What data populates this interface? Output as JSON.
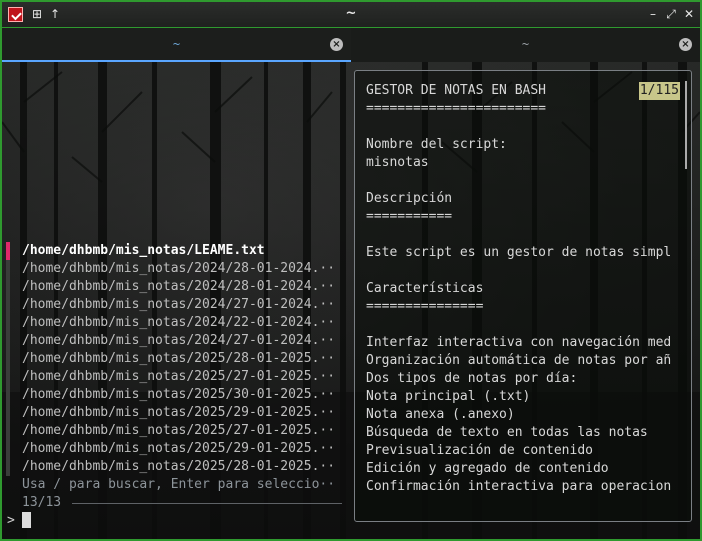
{
  "window": {
    "title": "~",
    "titlebar_buttons": {
      "grid": "⊞",
      "up": "↑",
      "minimize": "–",
      "maximize": "⤢",
      "close": "✕"
    },
    "border_color": "#2f9a2f"
  },
  "tabs": [
    {
      "label": "~",
      "active": true,
      "close": "×"
    },
    {
      "label": "~",
      "active": false,
      "close": "×"
    }
  ],
  "file_list": [
    "/home/dhbmb/mis_notas/LEAME.txt",
    "/home/dhbmb/mis_notas/2024/28-01-2024.··",
    "/home/dhbmb/mis_notas/2024/28-01-2024.··",
    "/home/dhbmb/mis_notas/2024/27-01-2024.··",
    "/home/dhbmb/mis_notas/2024/22-01-2024.··",
    "/home/dhbmb/mis_notas/2024/27-01-2024.··",
    "/home/dhbmb/mis_notas/2025/28-01-2025.··",
    "/home/dhbmb/mis_notas/2025/27-01-2025.··",
    "/home/dhbmb/mis_notas/2025/30-01-2025.··",
    "/home/dhbmb/mis_notas/2025/29-01-2025.··",
    "/home/dhbmb/mis_notas/2025/27-01-2025.··",
    "/home/dhbmb/mis_notas/2025/29-01-2025.··",
    "/home/dhbmb/mis_notas/2025/28-01-2025.··"
  ],
  "selected_index": 0,
  "hint": "Usa / para buscar, Enter para seleccio··",
  "counter": "13/13",
  "prompt": ">",
  "preview": {
    "position": "1/115",
    "lines": [
      "GESTOR DE NOTAS EN BASH",
      "=======================",
      "",
      "Nombre del script:",
      "misnotas",
      "",
      "Descripción",
      "===========",
      "",
      "Este script es un gestor de notas simpl",
      "",
      "Características",
      "===============",
      "",
      "Interfaz interactiva con navegación med",
      "Organización automática de notas por añ",
      "Dos tipos de notas por día:",
      "Nota principal (.txt)",
      "Nota anexa (.anexo)",
      "Búsqueda de texto en todas las notas",
      "Previsualización de contenido",
      "Edición y agregado de contenido",
      "Confirmación interactiva para operacion"
    ]
  },
  "colors": {
    "selection_marker": "#e0286a",
    "active_tab_underline": "#5aa6ff",
    "position_badge": "#c8c68a"
  }
}
